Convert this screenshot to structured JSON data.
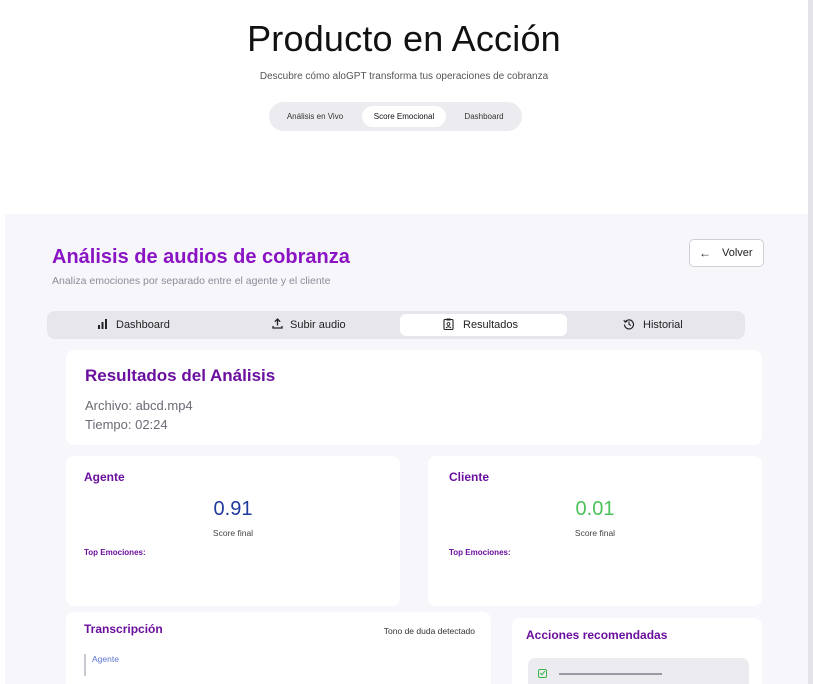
{
  "hero": {
    "title": "Producto en Acción",
    "subtitle": "Descubre cómo aloGPT transforma tus operaciones de cobranza",
    "tabs": [
      {
        "label": "Análisis en Vivo",
        "active": false
      },
      {
        "label": "Score Emocional",
        "active": true
      },
      {
        "label": "Dashboard",
        "active": false
      }
    ]
  },
  "app": {
    "title": "Análisis de audios de cobranza",
    "subtitle": "Analiza emociones por separado entre el agente y el cliente",
    "back_button": {
      "label": "Volver",
      "icon": "arrow-left-icon"
    },
    "tabs": [
      {
        "label": "Dashboard",
        "icon": "bar-chart-icon",
        "active": false
      },
      {
        "label": "Subir audio",
        "icon": "upload-icon",
        "active": false
      },
      {
        "label": "Resultados",
        "icon": "report-icon",
        "active": true
      },
      {
        "label": "Historial",
        "icon": "history-icon",
        "active": false
      }
    ]
  },
  "results": {
    "title": "Resultados del Análisis",
    "file_line": "Archivo: abcd.mp4",
    "time_line": "Tiempo: 02:24"
  },
  "agent": {
    "title": "Agente",
    "score": "0.91",
    "score_label": "Score final",
    "top_emotions_label": "Top Emociones:",
    "score_color": "#1f3b9c"
  },
  "client": {
    "title": "Cliente",
    "score": "0.01",
    "score_label": "Score final",
    "top_emotions_label": "Top Emociones:",
    "score_color": "#4cc35a"
  },
  "transcription": {
    "title": "Transcripción",
    "tone": "Tono de duda detectado",
    "speaker": "Agente"
  },
  "actions": {
    "title": "Acciones recomendadas",
    "items": [
      {
        "icon": "checkbox-checked-icon"
      }
    ]
  },
  "colors": {
    "accent_purple": "#8a14c4",
    "heading_purple": "#6a0f9e",
    "app_background": "#f7f6fb"
  }
}
